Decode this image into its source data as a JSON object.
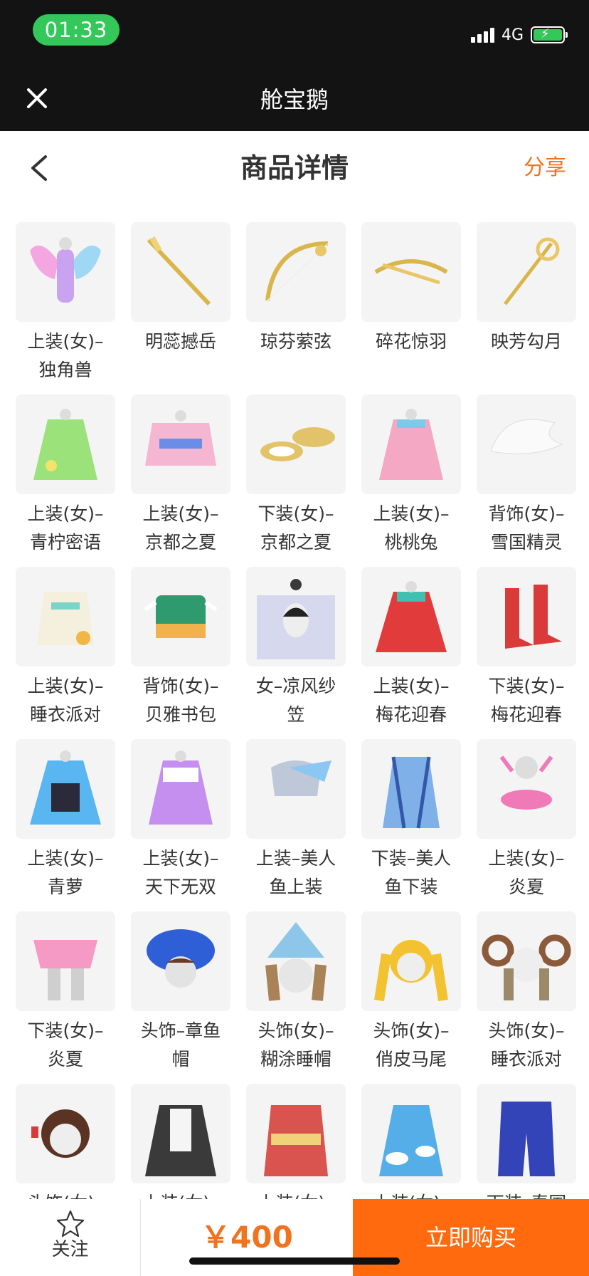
{
  "status_bar": {
    "time": "01:33",
    "network": "4G"
  },
  "app_bar": {
    "title": "舱宝鹅"
  },
  "header": {
    "title": "商品详情",
    "share_label": "分享"
  },
  "products": [
    {
      "name": "上装(女)–\n独角兽",
      "icon": "wings-outfit"
    },
    {
      "name": "明蕊撼岳",
      "icon": "golden-sword"
    },
    {
      "name": "琼芬萦弦",
      "icon": "golden-bow"
    },
    {
      "name": "碎花惊羽",
      "icon": "golden-crossbow"
    },
    {
      "name": "映芳勾月",
      "icon": "golden-staff"
    },
    {
      "name": "上装(女)–\n青柠密语",
      "icon": "green-dress"
    },
    {
      "name": "上装(女)–\n京都之夏",
      "icon": "kimono-top"
    },
    {
      "name": "下装(女)–\n京都之夏",
      "icon": "sandals"
    },
    {
      "name": "上装(女)–\n桃桃兔",
      "icon": "pink-dress"
    },
    {
      "name": "背饰(女)–\n雪国精灵",
      "icon": "white-wings"
    },
    {
      "name": "上装(女)–\n睡衣派对",
      "icon": "pajama-top"
    },
    {
      "name": "背饰(女)–\n贝雅书包",
      "icon": "green-backpack"
    },
    {
      "name": "女–凉风纱\n笠",
      "icon": "veil-hat"
    },
    {
      "name": "上装(女)–\n梅花迎春",
      "icon": "red-dress"
    },
    {
      "name": "下装(女)–\n梅花迎春",
      "icon": "red-boots"
    },
    {
      "name": "上装(女)–\n青萝",
      "icon": "blue-dress"
    },
    {
      "name": "上装(女)–\n天下无双",
      "icon": "purple-dress"
    },
    {
      "name": "上装–美人\n鱼上装",
      "icon": "mermaid-top"
    },
    {
      "name": "下装–美人\n鱼下装",
      "icon": "mermaid-tail"
    },
    {
      "name": "上装(女)–\n炎夏",
      "icon": "pink-bikini"
    },
    {
      "name": "下装(女)–\n炎夏",
      "icon": "pink-skirt"
    },
    {
      "name": "头饰–章鱼\n帽",
      "icon": "octopus-hat"
    },
    {
      "name": "头饰(女)–\n糊涂睡帽",
      "icon": "sleep-cap"
    },
    {
      "name": "头饰(女)–\n俏皮马尾",
      "icon": "blonde-ponytail"
    },
    {
      "name": "头饰(女)–\n睡衣派对",
      "icon": "ram-horns"
    },
    {
      "name": "头饰(女)–",
      "icon": "brown-hair"
    },
    {
      "name": "上装(女)–",
      "icon": "maid-dress"
    },
    {
      "name": "上装(女)–",
      "icon": "red-robe"
    },
    {
      "name": "上装(女)–",
      "icon": "cloud-dress"
    },
    {
      "name": "下装–泰国",
      "icon": "blue-pants"
    }
  ],
  "bottom_bar": {
    "follow_label": "关注",
    "price": "￥400",
    "buy_label": "立即购买"
  },
  "colors": {
    "accent": "#f0731f",
    "buy_button": "#ff6a0e",
    "status_pill": "#34c759",
    "topbar": "#131313"
  }
}
